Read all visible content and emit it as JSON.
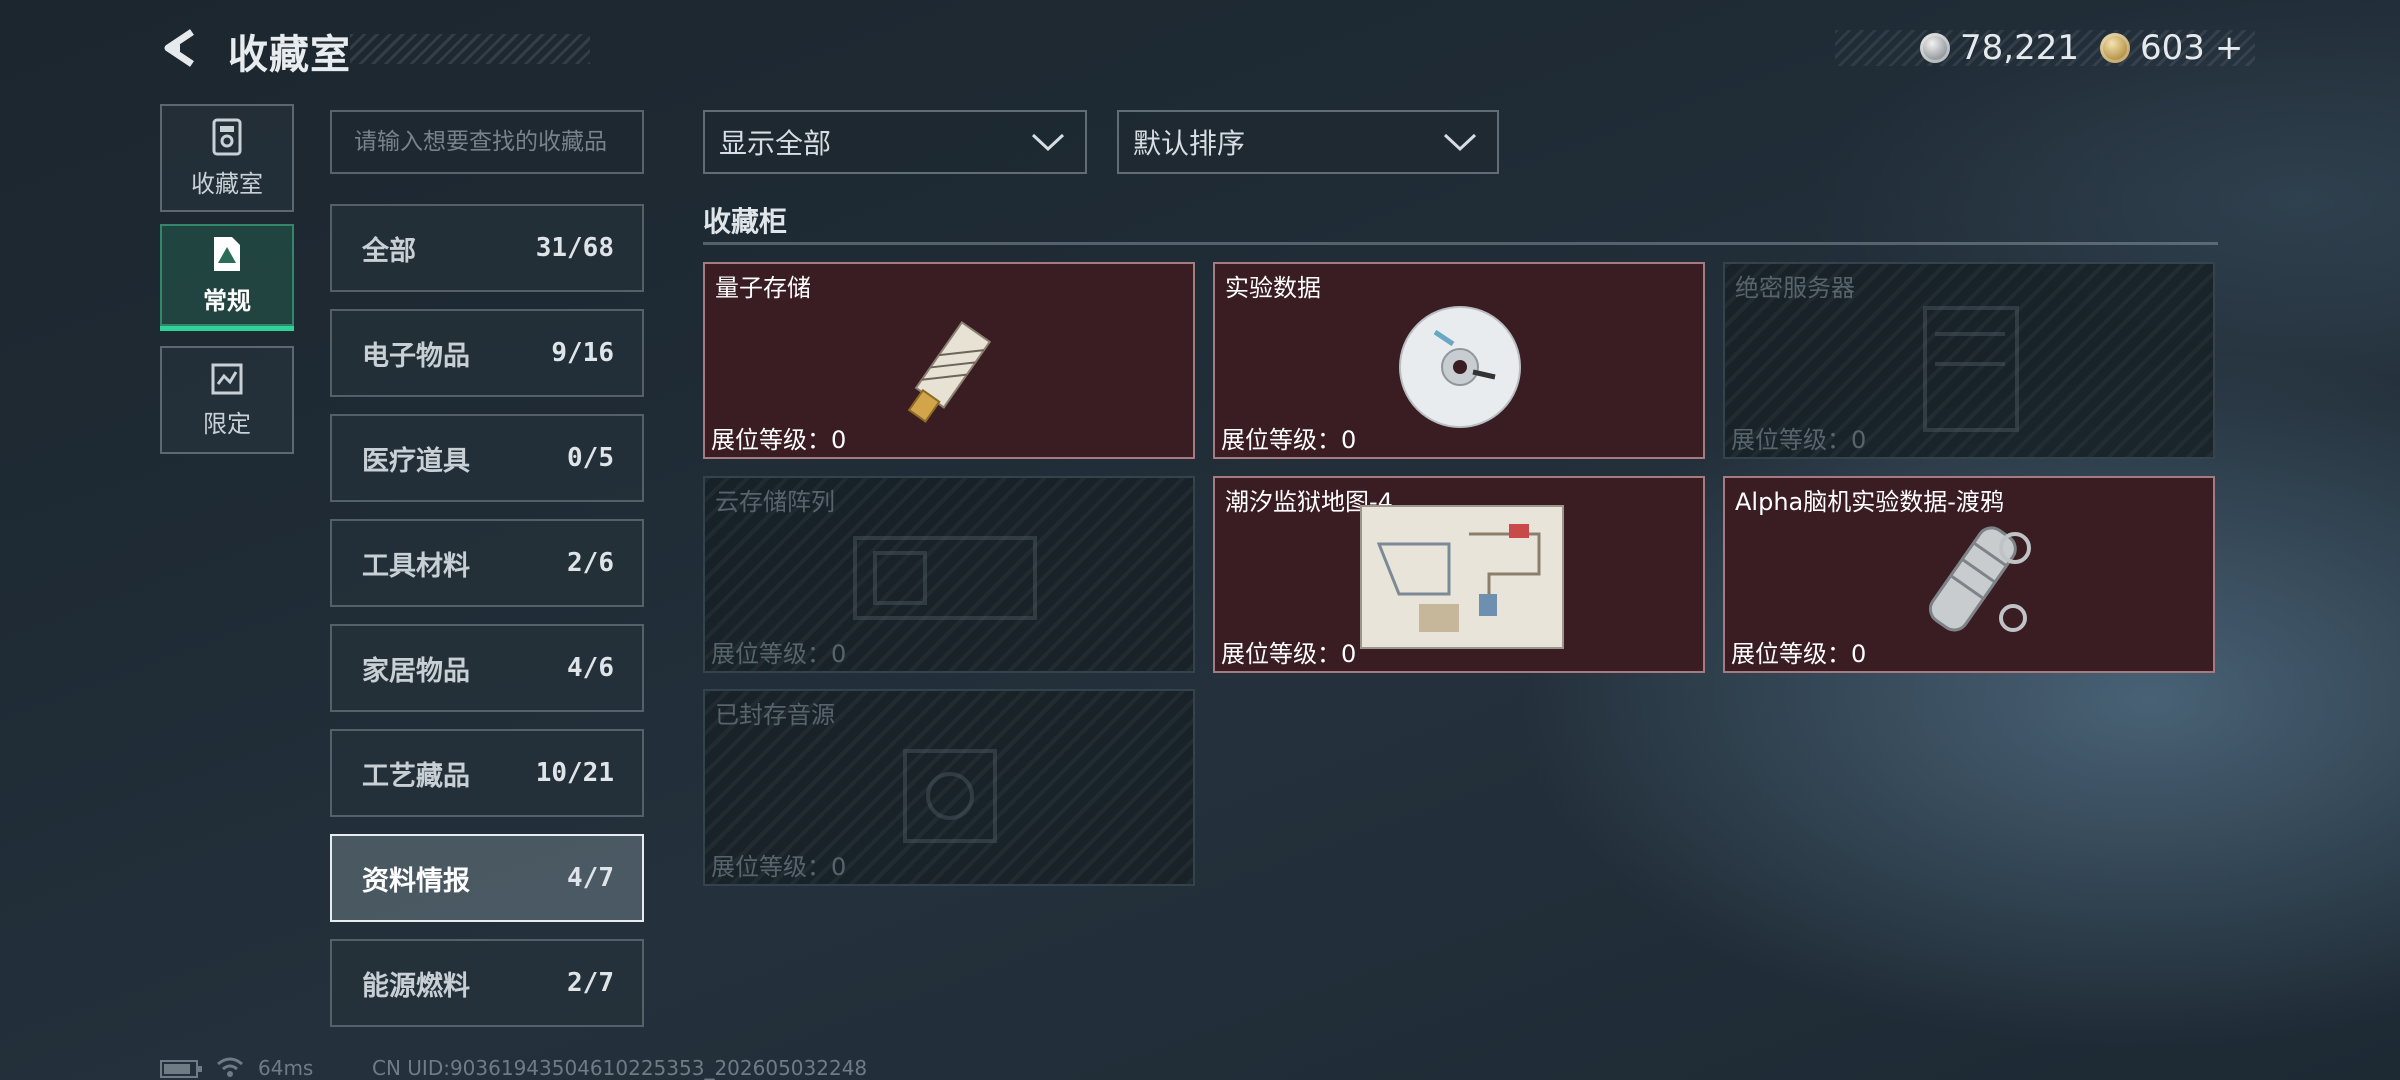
{
  "header": {
    "title": "收藏室",
    "currency": [
      {
        "icon": "silver-coin-icon",
        "value": "78,221"
      },
      {
        "icon": "gold-coin-icon",
        "value": "603",
        "add": "+"
      }
    ]
  },
  "side_tabs": [
    {
      "label": "收藏室",
      "icon": "collection-room-icon"
    },
    {
      "label": "常规",
      "icon": "regular-icon",
      "active": true
    },
    {
      "label": "限定",
      "icon": "limited-icon"
    }
  ],
  "search": {
    "placeholder": "请输入想要查找的收藏品",
    "value": ""
  },
  "categories": [
    {
      "name": "全部",
      "count": "31/68"
    },
    {
      "name": "电子物品",
      "count": "9/16"
    },
    {
      "name": "医疗道具",
      "count": "0/5"
    },
    {
      "name": "工具材料",
      "count": "2/6"
    },
    {
      "name": "家居物品",
      "count": "4/6"
    },
    {
      "name": "工艺藏品",
      "count": "10/21"
    },
    {
      "name": "资料情报",
      "count": "4/7",
      "active": true
    },
    {
      "name": "能源燃料",
      "count": "2/7"
    }
  ],
  "filters": {
    "show": "显示全部",
    "sort": "默认排序"
  },
  "section": {
    "title": "收藏柜"
  },
  "level_label": "展位等级：",
  "items": [
    {
      "name": "量子存储",
      "level": "0",
      "owned": true,
      "icon": "usb-drive-icon"
    },
    {
      "name": "实验数据",
      "level": "0",
      "owned": true,
      "icon": "cd-disc-icon"
    },
    {
      "name": "绝密服务器",
      "level": "0",
      "owned": false,
      "icon": "server-icon"
    },
    {
      "name": "云存储阵列",
      "level": "0",
      "owned": false,
      "icon": "storage-array-icon"
    },
    {
      "name": "潮汐监狱地图-4",
      "level": "0",
      "owned": true,
      "icon": "map-icon"
    },
    {
      "name": "Alpha脑机实验数据-渡鸦",
      "level": "0",
      "owned": true,
      "icon": "data-canister-icon"
    },
    {
      "name": "已封存音源",
      "level": "0",
      "owned": false,
      "icon": "audio-device-icon"
    }
  ],
  "status_bar": {
    "ping": "64ms",
    "uid": "CN UID:90361943504610225353_202605032248"
  },
  "colors": {
    "accent": "#2fd39a",
    "owned_card": "#3a1c23",
    "locked_card": "#1b252c"
  }
}
